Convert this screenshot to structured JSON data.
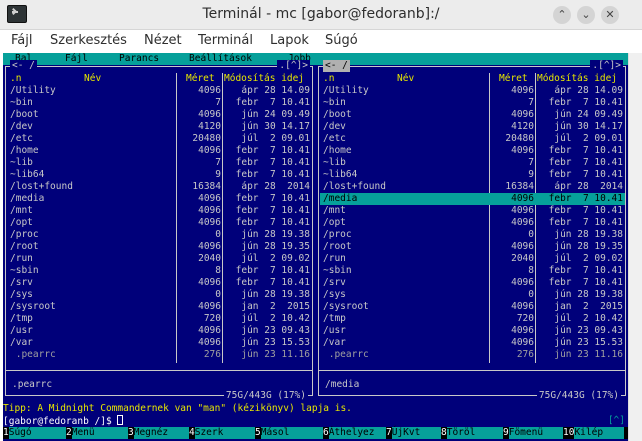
{
  "window": {
    "title": "Terminál - mc [gabor@fedoranb]:/",
    "btn_up": "⌃",
    "btn_down": "⌄",
    "btn_close": "✕"
  },
  "menubar": [
    "Fájl",
    "Szerkesztés",
    "Nézet",
    "Terminál",
    "Lapok",
    "Súgó"
  ],
  "mc_menu": [
    "Bal",
    "Fájl",
    "Parancs",
    "Beállítások",
    "Jobb"
  ],
  "panel_common": {
    "col_name_prefix": ".n",
    "col_name": "Név",
    "col_size": "Méret",
    "col_mtime": "Módosítás idej",
    "controls": ".[^]>"
  },
  "left_panel": {
    "path": "/",
    "mini_status": ".pearrc",
    "disk_info": "75G/443G (17%)"
  },
  "right_panel": {
    "path": "/",
    "mini_status": "/media",
    "disk_info": "75G/443G (17%)"
  },
  "files": [
    {
      "name": "/Utility",
      "size": "4096",
      "mtime": "ápr 28 14.09"
    },
    {
      "name": "~bin",
      "size": "7",
      "mtime": "febr  7 10.41"
    },
    {
      "name": "/boot",
      "size": "4096",
      "mtime": "jún 24 09.49"
    },
    {
      "name": "/dev",
      "size": "4120",
      "mtime": "jún 30 14.17"
    },
    {
      "name": "/etc",
      "size": "20480",
      "mtime": "júl  2 09.01"
    },
    {
      "name": "/home",
      "size": "4096",
      "mtime": "febr  7 10.41"
    },
    {
      "name": "~lib",
      "size": "7",
      "mtime": "febr  7 10.41"
    },
    {
      "name": "~lib64",
      "size": "9",
      "mtime": "febr  7 10.41"
    },
    {
      "name": "/lost+found",
      "size": "16384",
      "mtime": "ápr 28  2014"
    },
    {
      "name": "/media",
      "size": "4096",
      "mtime": "febr  7 10.41"
    },
    {
      "name": "/mnt",
      "size": "4096",
      "mtime": "febr  7 10.41"
    },
    {
      "name": "/opt",
      "size": "4096",
      "mtime": "febr  7 10.41"
    },
    {
      "name": "/proc",
      "size": "0",
      "mtime": "jún 28 19.38"
    },
    {
      "name": "/root",
      "size": "4096",
      "mtime": "jún 28 19.35"
    },
    {
      "name": "/run",
      "size": "2040",
      "mtime": "júl  2 09.02"
    },
    {
      "name": "~sbin",
      "size": "8",
      "mtime": "febr  7 10.41"
    },
    {
      "name": "/srv",
      "size": "4096",
      "mtime": "febr  7 10.41"
    },
    {
      "name": "/sys",
      "size": "0",
      "mtime": "jún 28 19.38"
    },
    {
      "name": "/sysroot",
      "size": "4096",
      "mtime": "jan  2  2015"
    },
    {
      "name": "/tmp",
      "size": "720",
      "mtime": "júl  2 10.42"
    },
    {
      "name": "/usr",
      "size": "4096",
      "mtime": "jún 23 09.43"
    },
    {
      "name": "/var",
      "size": "4096",
      "mtime": "jún 23 15.53"
    },
    {
      "name": " .pearrc",
      "size": "276",
      "mtime": "jún 23 11.16"
    }
  ],
  "right_selected_index": 9,
  "tip": "Tipp: A Midnight Commandernek van \"man\" (kézikönyv) lapja is.",
  "prompt": "[gabor@fedoranb /]$ ",
  "prompt_ctrl": "[^]",
  "fkeys": [
    {
      "num": "1",
      "label": "Súgó"
    },
    {
      "num": "2",
      "label": "Menü"
    },
    {
      "num": "3",
      "label": "Megnéz"
    },
    {
      "num": "4",
      "label": "Szerk"
    },
    {
      "num": "5",
      "label": "Másol"
    },
    {
      "num": "6",
      "label": "Áthelyez"
    },
    {
      "num": "7",
      "label": "ÚjKvt"
    },
    {
      "num": "8",
      "label": "Töröl"
    },
    {
      "num": "9",
      "label": "Fömenü"
    },
    {
      "num": "10",
      "label": "Kilép"
    }
  ],
  "colors": {
    "terminal_bg": "#00007a",
    "highlight": "#06a09a",
    "header_yellow": "#e6e600"
  }
}
